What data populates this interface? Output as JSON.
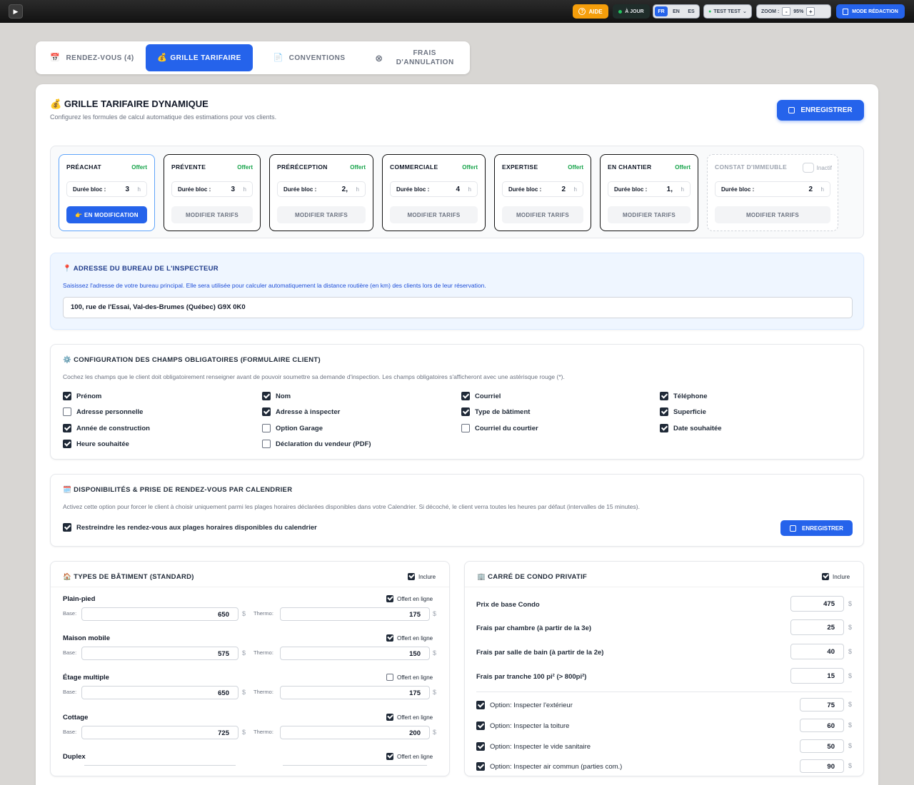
{
  "topbar": {
    "play_icon": "play-icon",
    "help": "AIDE",
    "status": "À JOUR",
    "lang": [
      "FR",
      "EN",
      "ES"
    ],
    "user": "TEST TEST",
    "zoom_label": "ZOOM :",
    "zoom_value": "95%",
    "zoom_minus": "-",
    "zoom_plus": "+",
    "mode": "MODE RÉDACTION"
  },
  "tabs": [
    {
      "label": "RENDEZ-VOUS (4)",
      "icon": "📅"
    },
    {
      "label": "GRILLE TARIFAIRE",
      "icon": "💰"
    },
    {
      "label": "CONVENTIONS",
      "icon": "📄"
    },
    {
      "label": "FRAIS D'ANNULATION",
      "icon": "⊗"
    }
  ],
  "header": {
    "icon": "💰",
    "title": "GRILLE TARIFAIRE DYNAMIQUE",
    "subtitle": "Configurez les formules de calcul automatique des estimations pour vos clients.",
    "save": "ENREGISTRER"
  },
  "services": [
    {
      "name": "PRÉACHAT",
      "badge": "Offert",
      "dur_label": "Durée bloc :",
      "dur": "3",
      "unit": "h",
      "button": "👉 EN MODIFICATION"
    },
    {
      "name": "PRÉVENTE",
      "badge": "Offert",
      "dur_label": "Durée bloc :",
      "dur": "3",
      "unit": "h",
      "button": "MODIFIER TARIFS"
    },
    {
      "name": "PRÉRÉCEPTION",
      "badge": "Offert",
      "dur_label": "Durée bloc :",
      "dur": "2,",
      "unit": "h",
      "button": "MODIFIER TARIFS"
    },
    {
      "name": "COMMERCIALE",
      "badge": "Offert",
      "dur_label": "Durée bloc :",
      "dur": "4",
      "unit": "h",
      "button": "MODIFIER TARIFS"
    },
    {
      "name": "EXPERTISE",
      "badge": "Offert",
      "dur_label": "Durée bloc :",
      "dur": "2",
      "unit": "h",
      "button": "MODIFIER TARIFS"
    },
    {
      "name": "EN CHANTIER",
      "badge": "Offert",
      "dur_label": "Durée bloc :",
      "dur": "1,",
      "unit": "h",
      "button": "MODIFIER TARIFS"
    },
    {
      "name": "CONSTAT D'IMMEUBLE",
      "badge": "Inactif",
      "dur_label": "Durée bloc :",
      "dur": "2",
      "unit": "h",
      "button": "MODIFIER TARIFS"
    }
  ],
  "address": {
    "icon": "📍",
    "title": "ADRESSE DU BUREAU DE L'INSPECTEUR",
    "desc": "Saisissez l'adresse de votre bureau principal. Elle sera utilisée pour calculer automatiquement la distance routière (en km) des clients lors de leur réservation.",
    "value": "100, rue de l'Essai, Val-des-Brumes (Québec)  G9X 0K0"
  },
  "fields": {
    "icon": "⚙️",
    "title": "CONFIGURATION DES CHAMPS OBLIGATOIRES (FORMULAIRE CLIENT)",
    "desc": "Cochez les champs que le client doit obligatoirement renseigner avant de pouvoir soumettre sa demande d'inspection. Les champs obligatoires s'afficheront avec une astérisque rouge (*).",
    "items": [
      {
        "label": "Prénom",
        "checked": true
      },
      {
        "label": "Nom",
        "checked": true
      },
      {
        "label": "Courriel",
        "checked": true
      },
      {
        "label": "Téléphone",
        "checked": true
      },
      {
        "label": "Adresse personnelle",
        "checked": false
      },
      {
        "label": "Adresse à inspecter",
        "checked": true
      },
      {
        "label": "Type de bâtiment",
        "checked": true
      },
      {
        "label": "Superficie",
        "checked": true
      },
      {
        "label": "Année de construction",
        "checked": true
      },
      {
        "label": "Option Garage",
        "checked": false
      },
      {
        "label": "Courriel du courtier",
        "checked": false
      },
      {
        "label": "Date souhaitée",
        "checked": true
      },
      {
        "label": "Heure souhaitée",
        "checked": true
      },
      {
        "label": "Déclaration du vendeur (PDF)",
        "checked": false
      }
    ]
  },
  "calendar": {
    "icon": "🗓️",
    "title": "DISPONIBILITÉS & PRISE DE RENDEZ-VOUS PAR CALENDRIER",
    "desc": "Activez cette option pour forcer le client à choisir uniquement parmi les plages horaires déclarées disponibles dans votre Calendrier. Si décoché, le client verra toutes les heures par défaut (intervalles de 15 minutes).",
    "checkbox": "Restreindre les rendez-vous aux plages horaires disponibles du calendrier",
    "save": "ENREGISTRER"
  },
  "building_types": {
    "icon": "🏠",
    "title": "TYPES DE BÂTIMENT (STANDARD)",
    "include": "Inclure",
    "offered_label": "Offert en ligne",
    "base_label": "Base:",
    "thermo_label": "Thermo:",
    "currency": "$",
    "items": [
      {
        "name": "Plain-pied",
        "base": "650",
        "thermo": "175",
        "online": true
      },
      {
        "name": "Maison mobile",
        "base": "575",
        "thermo": "150",
        "online": true
      },
      {
        "name": "Étage multiple",
        "base": "650",
        "thermo": "175",
        "online": false
      },
      {
        "name": "Cottage",
        "base": "725",
        "thermo": "200",
        "online": true
      },
      {
        "name": "Duplex",
        "base": "",
        "thermo": "",
        "online": true
      }
    ]
  },
  "condo": {
    "icon": "🏢",
    "title": "CARRÉ DE CONDO PRIVATIF",
    "include": "Inclure",
    "currency": "$",
    "prices": [
      {
        "label": "Prix de base Condo",
        "value": "475"
      },
      {
        "label": "Frais par chambre (à partir de la 3e)",
        "value": "25"
      },
      {
        "label": "Frais par salle de bain (à partir de la 2e)",
        "value": "40"
      },
      {
        "label": "Frais par tranche 100 pi² (> 800pi²)",
        "value": "15"
      }
    ],
    "options": [
      {
        "label": "Option: Inspecter l'extérieur",
        "value": "75"
      },
      {
        "label": "Option: Inspecter la toiture",
        "value": "60"
      },
      {
        "label": "Option: Inspecter le vide sanitaire",
        "value": "50"
      },
      {
        "label": "Option: Inspecter air commun (parties com.)",
        "value": "90"
      }
    ]
  }
}
